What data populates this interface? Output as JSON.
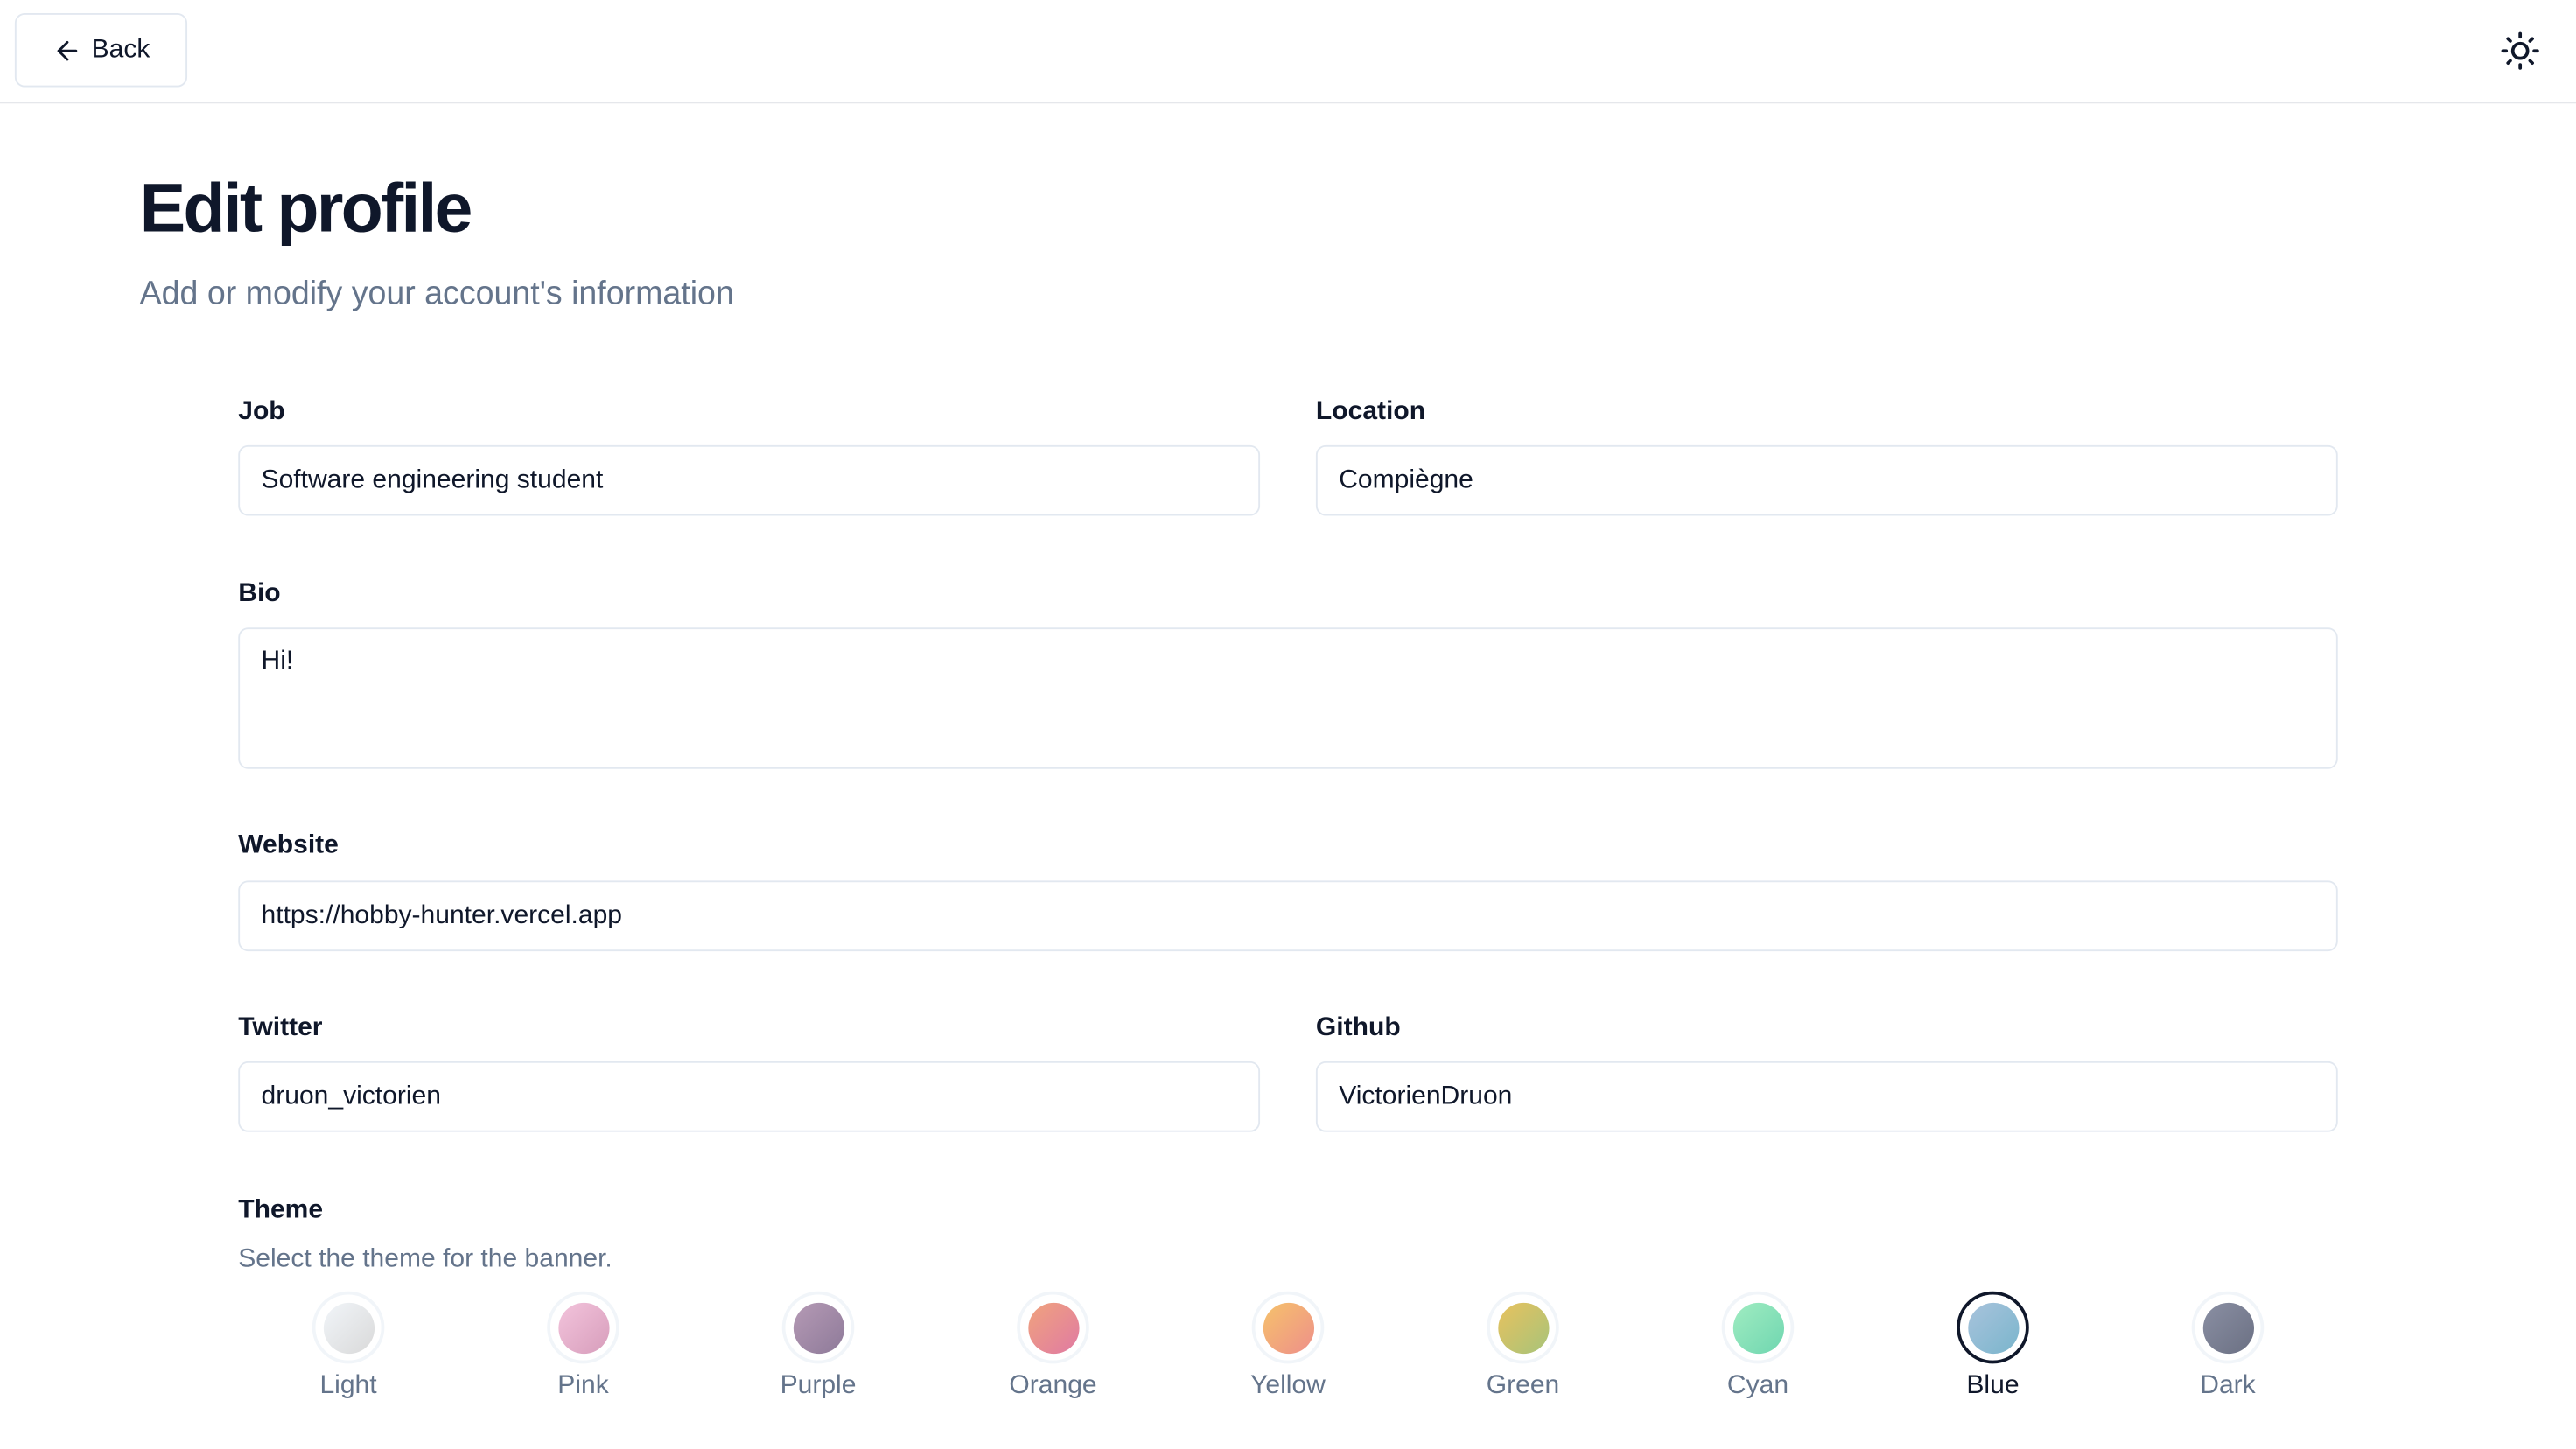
{
  "header": {
    "back_label": "Back",
    "theme_toggle_icon": "sun-icon"
  },
  "page": {
    "title": "Edit profile",
    "subtitle": "Add or modify your account's information"
  },
  "form": {
    "job": {
      "label": "Job",
      "value": "Software engineering student"
    },
    "location": {
      "label": "Location",
      "value": "Compiègne"
    },
    "bio": {
      "label": "Bio",
      "value": "Hi!"
    },
    "website": {
      "label": "Website",
      "value": "https://hobby-hunter.vercel.app"
    },
    "twitter": {
      "label": "Twitter",
      "value": "druon_victorien"
    },
    "github": {
      "label": "Github",
      "value": "VictorienDruon"
    }
  },
  "theme": {
    "label": "Theme",
    "description": "Select the theme for the banner.",
    "selected": "Blue",
    "options": [
      {
        "name": "Light",
        "from": "#f1f5f9",
        "to": "#d9d9d9"
      },
      {
        "name": "Pink",
        "from": "#f3c4dc",
        "to": "#d79dbb"
      },
      {
        "name": "Purple",
        "from": "#b59ab5",
        "to": "#8e7a99"
      },
      {
        "name": "Orange",
        "from": "#f0a37d",
        "to": "#e07aa3"
      },
      {
        "name": "Yellow",
        "from": "#f6c26b",
        "to": "#ee8f8a"
      },
      {
        "name": "Green",
        "from": "#e8c15e",
        "to": "#a7c47a"
      },
      {
        "name": "Cyan",
        "from": "#a0ecc1",
        "to": "#6fd6b0"
      },
      {
        "name": "Blue",
        "from": "#a8c3dc",
        "to": "#7ab5cc"
      },
      {
        "name": "Dark",
        "from": "#8a8fa3",
        "to": "#6b7083"
      }
    ]
  }
}
